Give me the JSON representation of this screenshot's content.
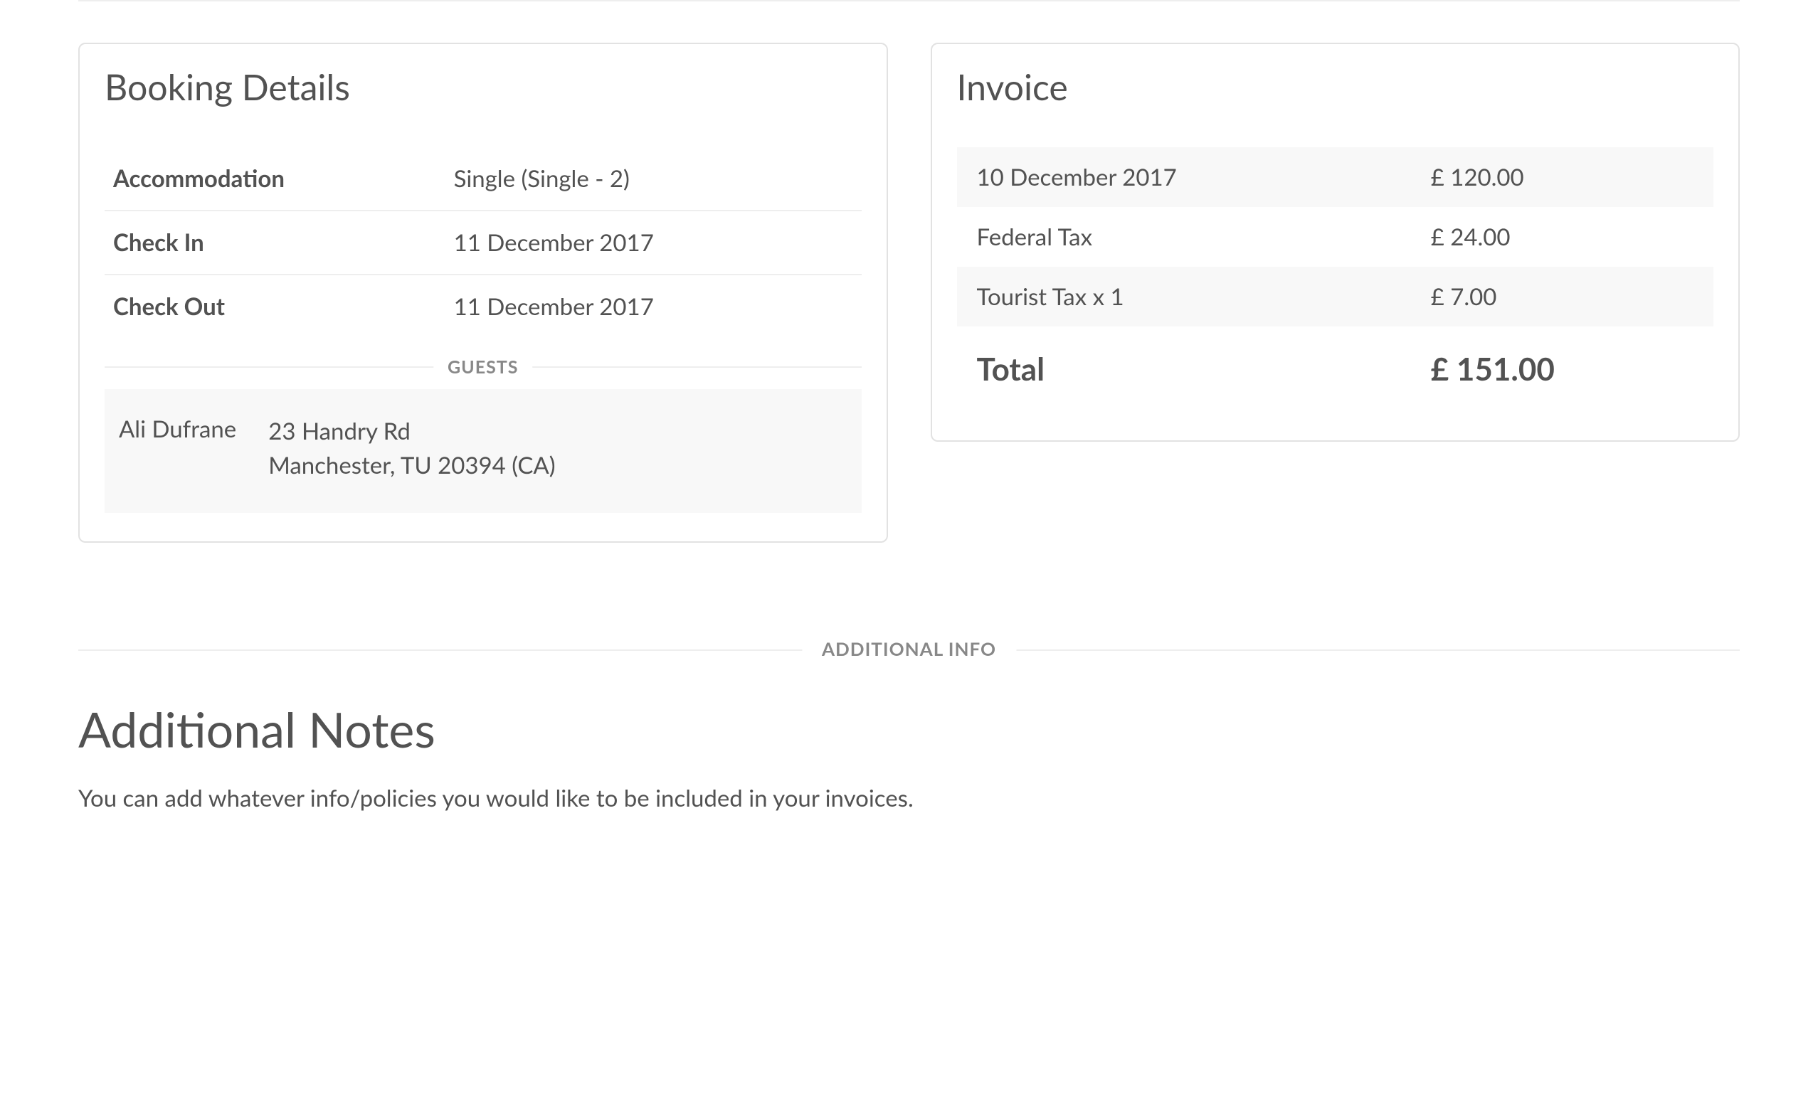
{
  "booking": {
    "title": "Booking Details",
    "rows": [
      {
        "label": "Accommodation",
        "value": "Single (Single - 2)"
      },
      {
        "label": "Check In",
        "value": "11 December 2017"
      },
      {
        "label": "Check Out",
        "value": "11 December 2017"
      }
    ],
    "guests_label": "GUESTS",
    "guest": {
      "name": "Ali Dufrane",
      "address_line1": "23 Handry Rd",
      "address_line2": "Manchester, TU 20394 (CA)"
    }
  },
  "invoice": {
    "title": "Invoice",
    "lines": [
      {
        "label": "10 December 2017",
        "amount": "£ 120.00"
      },
      {
        "label": "Federal Tax",
        "amount": "£ 24.00"
      },
      {
        "label": "Tourist Tax x 1",
        "amount": "£ 7.00"
      }
    ],
    "total_label": "Total",
    "total_amount": "£ 151.00"
  },
  "additional": {
    "divider_label": "ADDITIONAL INFO",
    "notes_title": "Additional Notes",
    "notes_body": "You can add whatever info/policies you would like to be included in your invoices."
  }
}
